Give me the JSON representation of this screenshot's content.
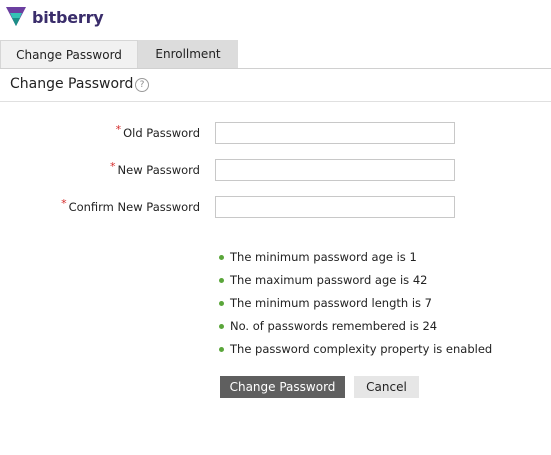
{
  "brand": {
    "name": "bitberry",
    "colors": {
      "purple": "#6b3fa0",
      "teal": "#34c3b5",
      "text": "#3a2d6b"
    }
  },
  "tabs": [
    {
      "label": "Change Password",
      "active": true
    },
    {
      "label": "Enrollment",
      "active": false
    }
  ],
  "section": {
    "title": "Change Password",
    "help_icon": "question-circle-icon"
  },
  "form": {
    "fields": [
      {
        "label": "Old Password",
        "required": true,
        "value": ""
      },
      {
        "label": "New Password",
        "required": true,
        "value": ""
      },
      {
        "label": "Confirm New Password",
        "required": true,
        "value": ""
      }
    ],
    "required_marker": "*"
  },
  "policy": [
    "The minimum password age is 1",
    "The maximum password age is 42",
    "The minimum password length is 7",
    "No. of passwords remembered is 24",
    "The password complexity property is enabled"
  ],
  "buttons": {
    "submit": "Change Password",
    "cancel": "Cancel"
  },
  "colors": {
    "primary_button": "#5f5f5f",
    "bullet": "#5aa63a",
    "required": "#d42a2a"
  }
}
